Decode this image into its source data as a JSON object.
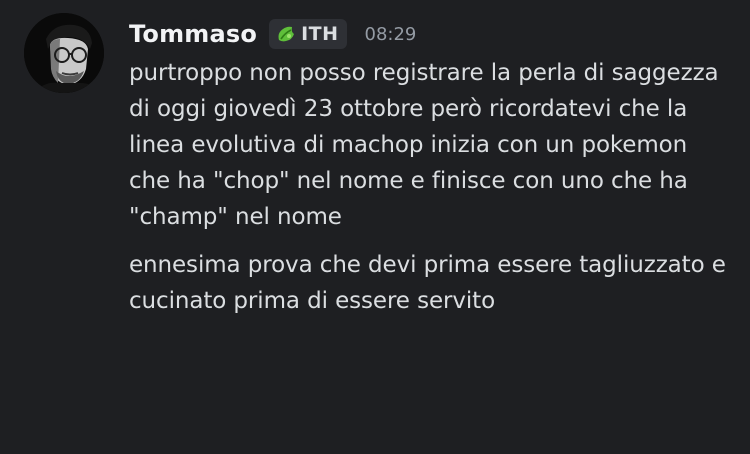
{
  "message": {
    "author": "Tommaso",
    "guild_tag": {
      "icon": "leaf-badge-icon",
      "text": "ITH"
    },
    "timestamp": "08:29",
    "paragraphs": [
      "purtroppo non posso registrare la perla di saggezza di oggi giovedì 23 ottobre però ricordatevi che la linea evolutiva di machop inizia con un pokemon che ha \"chop\" nel nome e finisce con uno che ha \"champ\" nel nome",
      "ennesima prova che devi prima essere tagliuzzato e cucinato prima di essere servito"
    ]
  },
  "colors": {
    "background": "#1e1f22",
    "username": "#f2f3f5",
    "text": "#dbdee1",
    "timestamp": "#949ba4",
    "tag_background": "#2e3035",
    "tag_icon": "#5fbf3a"
  }
}
